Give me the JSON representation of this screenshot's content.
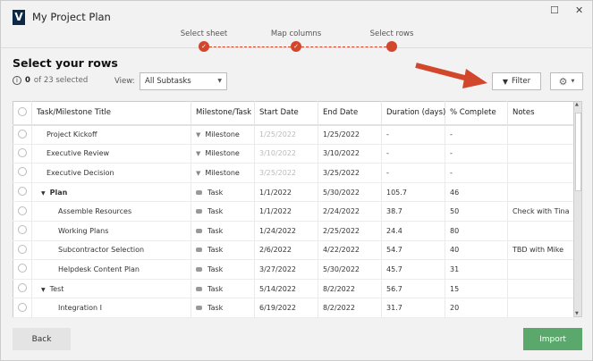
{
  "window": {
    "title": "My Project Plan",
    "logo_letter": "V",
    "maximize": "☐",
    "close": "✕"
  },
  "steps": [
    {
      "label": "Select sheet",
      "done": true
    },
    {
      "label": "Map columns",
      "done": true
    },
    {
      "label": "Select rows",
      "done": false
    }
  ],
  "accent": "#d2462c",
  "heading": "Select your rows",
  "selection": {
    "count": "0",
    "text": "of 23 selected"
  },
  "view": {
    "label": "View:",
    "value": "All Subtasks"
  },
  "filter_label": "Filter",
  "columns": [
    "Task/Milestone Title",
    "Milestone/Task",
    "Start Date",
    "End Date",
    "Duration (days)",
    "% Complete",
    "Notes"
  ],
  "rows": [
    {
      "title": "Project Kickoff",
      "level": 1,
      "type": "Milestone",
      "start": "1/25/2022",
      "end": "1/25/2022",
      "duration": "-",
      "pct": "-",
      "notes": ""
    },
    {
      "title": "Executive Review",
      "level": 1,
      "type": "Milestone",
      "start": "3/10/2022",
      "end": "3/10/2022",
      "duration": "-",
      "pct": "-",
      "notes": ""
    },
    {
      "title": "Executive Decision",
      "level": 1,
      "type": "Milestone",
      "start": "3/25/2022",
      "end": "3/25/2022",
      "duration": "-",
      "pct": "-",
      "notes": ""
    },
    {
      "title": "Plan",
      "level": 0,
      "parent": true,
      "bold": true,
      "type": "Task",
      "start": "1/1/2022",
      "end": "5/30/2022",
      "duration": "105.7",
      "pct": "46",
      "notes": ""
    },
    {
      "title": "Assemble Resources",
      "level": 2,
      "type": "Task",
      "start": "1/1/2022",
      "end": "2/24/2022",
      "duration": "38.7",
      "pct": "50",
      "notes": "Check with Tina"
    },
    {
      "title": "Working Plans",
      "level": 2,
      "type": "Task",
      "start": "1/24/2022",
      "end": "2/25/2022",
      "duration": "24.4",
      "pct": "80",
      "notes": ""
    },
    {
      "title": "Subcontractor Selection",
      "level": 2,
      "type": "Task",
      "start": "2/6/2022",
      "end": "4/22/2022",
      "duration": "54.7",
      "pct": "40",
      "notes": "TBD with Mike"
    },
    {
      "title": "Helpdesk Content Plan",
      "level": 2,
      "type": "Task",
      "start": "3/27/2022",
      "end": "5/30/2022",
      "duration": "45.7",
      "pct": "31",
      "notes": ""
    },
    {
      "title": "Test",
      "level": 0,
      "parent": true,
      "type": "Task",
      "start": "5/14/2022",
      "end": "8/2/2022",
      "duration": "56.7",
      "pct": "15",
      "notes": ""
    },
    {
      "title": "Integration I",
      "level": 2,
      "type": "Task",
      "start": "6/19/2022",
      "end": "8/2/2022",
      "duration": "31.7",
      "pct": "20",
      "notes": ""
    }
  ],
  "footer": {
    "back": "Back",
    "import": "Import"
  }
}
